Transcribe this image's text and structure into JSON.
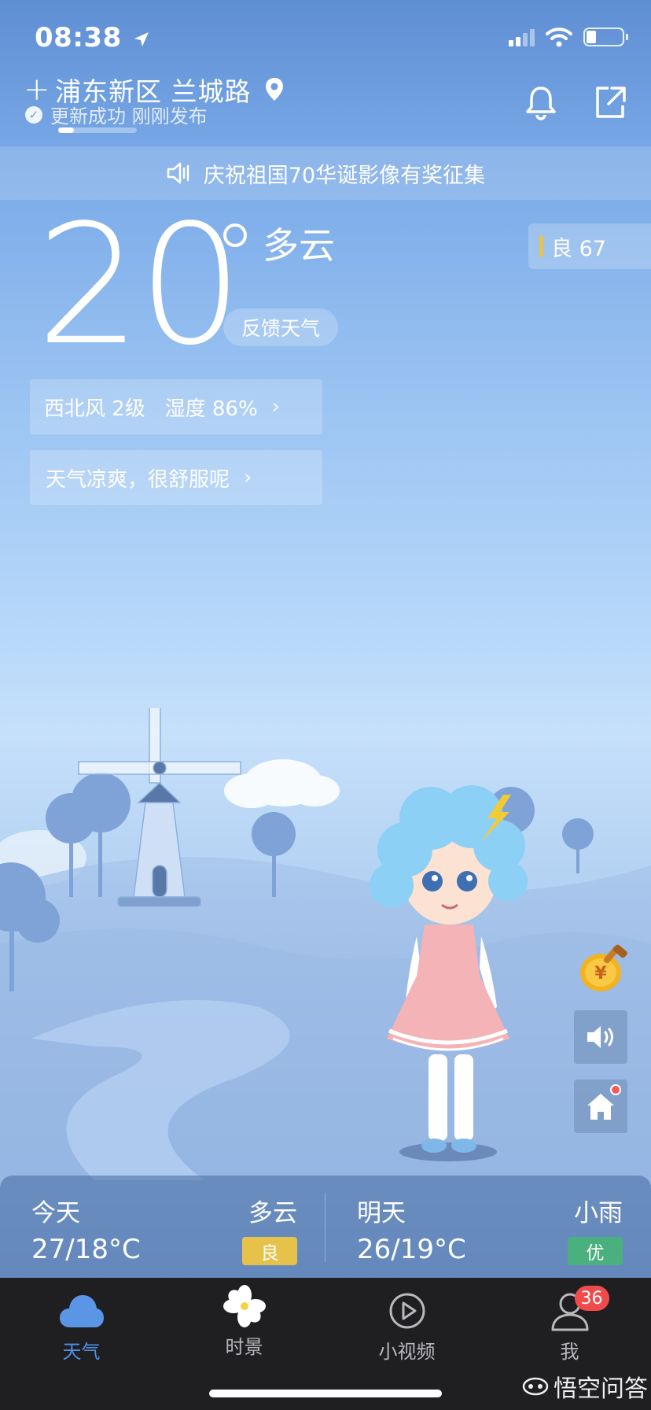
{
  "status_bar": {
    "time": "08:38"
  },
  "header": {
    "location": "浦东新区 兰城路",
    "update_status": "更新成功 刚刚发布",
    "update_progress": 0.2
  },
  "banner": {
    "text": "庆祝祖国70华诞影像有奖征集"
  },
  "current": {
    "temperature": "20",
    "condition": "多云",
    "feedback_label": "反馈天气",
    "aqi_label": "良 67",
    "aqi_color": "#e9c24c",
    "wind_humidity": "西北风 2级   湿度 86%",
    "comfort": "天气凉爽，很舒服呢"
  },
  "forecast": [
    {
      "day": "今天",
      "condition": "多云",
      "temp": "27/18°C",
      "aqi": "良",
      "aqi_color": "#e7c24a"
    },
    {
      "day": "明天",
      "condition": "小雨",
      "temp": "26/19°C",
      "aqi": "优",
      "aqi_color": "#49b07e"
    }
  ],
  "tabs": [
    {
      "label": "天气",
      "icon": "cloud-icon",
      "active": true
    },
    {
      "label": "时景",
      "icon": "flower-icon",
      "active": false
    },
    {
      "label": "小视频",
      "icon": "play-icon",
      "active": false
    },
    {
      "label": "我",
      "icon": "user-icon",
      "active": false,
      "badge": "36"
    }
  ],
  "watermark": "悟空问答",
  "colors": {
    "accent": "#4f8fe6",
    "tabbar_bg": "#1f1f22",
    "badge_red": "#f04b4b"
  }
}
